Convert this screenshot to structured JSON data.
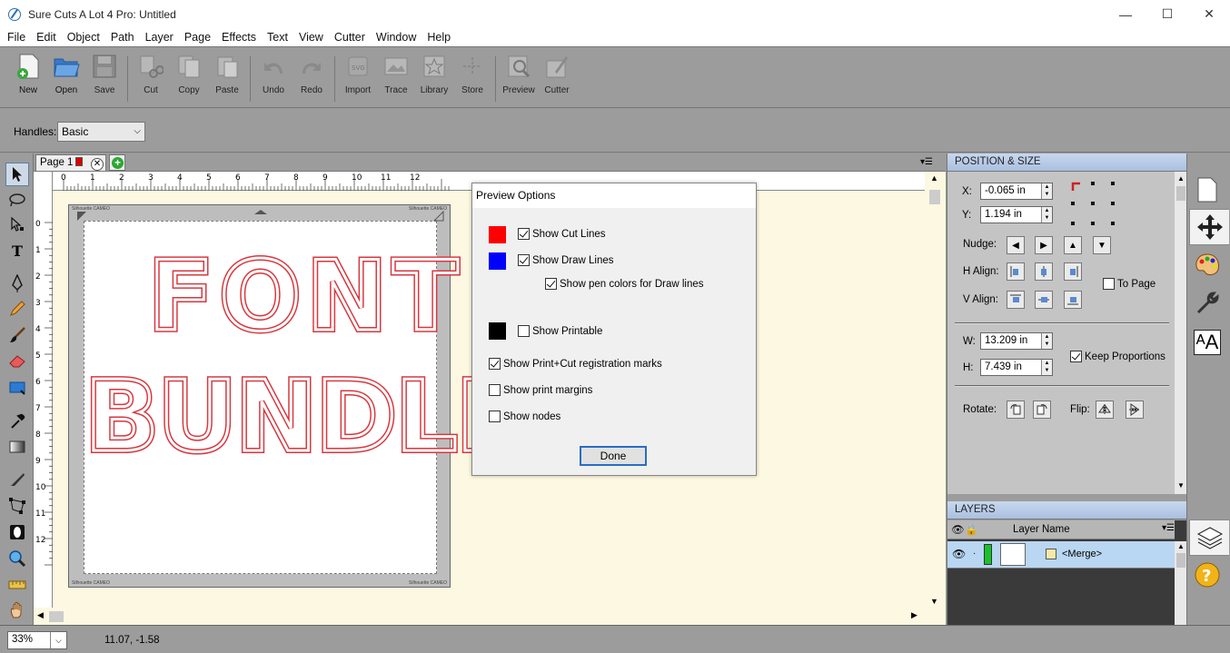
{
  "window": {
    "title": "Sure Cuts A Lot 4 Pro: Untitled",
    "minimize": "—",
    "maximize": "☐",
    "close": "✕"
  },
  "menu": [
    "File",
    "Edit",
    "Object",
    "Path",
    "Layer",
    "Page",
    "Effects",
    "Text",
    "View",
    "Cutter",
    "Window",
    "Help"
  ],
  "toolbar": {
    "new": "New",
    "open": "Open",
    "save": "Save",
    "cut": "Cut",
    "copy": "Copy",
    "paste": "Paste",
    "undo": "Undo",
    "redo": "Redo",
    "import": "Import",
    "trace": "Trace",
    "library": "Library",
    "store": "Store",
    "preview": "Preview",
    "cutter": "Cutter"
  },
  "options": {
    "handles_label": "Handles:",
    "handles_value": "Basic"
  },
  "tabs": {
    "page_label": "Page 1"
  },
  "ruler": {
    "h": [
      "0",
      "1",
      "2",
      "3",
      "4",
      "5",
      "6",
      "7",
      "8",
      "9",
      "10",
      "11",
      "12"
    ],
    "v": [
      "0",
      "1",
      "2",
      "3",
      "4",
      "5",
      "6",
      "7",
      "8",
      "9",
      "10",
      "11",
      "12"
    ]
  },
  "mat": {
    "brand_tl": "Silhouette CAMEO",
    "brand_tr": "Silhouette CAMEO",
    "brand_bl": "Silhouette CAMEO",
    "brand_br": "Silhouette CAMEO"
  },
  "design": {
    "line1": "FONT",
    "line2": "BUNDLES",
    "stroke_color": "#d9363e"
  },
  "dialog": {
    "title": "Preview Options",
    "show_cut_lines": "Show Cut Lines",
    "show_draw_lines": "Show Draw Lines",
    "show_pen_colors": "Show pen colors for Draw lines",
    "show_printable": "Show Printable",
    "show_reg_marks": "Show Print+Cut registration marks",
    "show_print_margins": "Show print margins",
    "show_nodes": "Show nodes",
    "done": "Done",
    "colors": {
      "cut": "#ff0000",
      "draw": "#0000ff",
      "printable": "#000000"
    }
  },
  "position_size": {
    "header": "POSITION & SIZE",
    "x_label": "X:",
    "x_value": "-0.065 in",
    "y_label": "Y:",
    "y_value": "1.194 in",
    "nudge_label": "Nudge:",
    "halign_label": "H Align:",
    "valign_label": "V Align:",
    "to_page": "To Page",
    "w_label": "W:",
    "w_value": "13.209 in",
    "h_label": "H:",
    "h_value": "7.439 in",
    "keep_proportions": "Keep Proportions",
    "rotate_label": "Rotate:",
    "flip_label": "Flip:"
  },
  "layers": {
    "header": "LAYERS",
    "column": "Layer Name",
    "row_name": "<Merge>",
    "row_color": "#19c22a"
  },
  "status": {
    "zoom": "33%",
    "coords": "11.07, -1.58"
  }
}
